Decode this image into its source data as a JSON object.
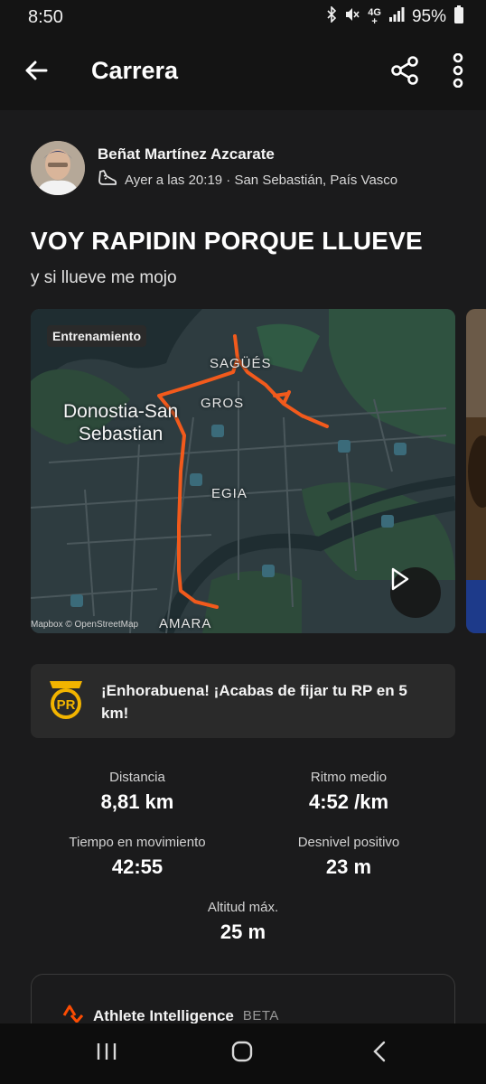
{
  "status_bar": {
    "time": "8:50",
    "network_top": "4G",
    "network_bottom": "+",
    "battery": "95%"
  },
  "app_bar": {
    "title": "Carrera",
    "back_icon": "arrow-left-icon",
    "share_icon": "share-icon",
    "more_icon": "more-vertical-icon"
  },
  "athlete": {
    "name": "Beñat Martínez Azcarate",
    "meta": "Ayer a las 20:19 · San Sebastián, País Vasco",
    "sport_icon": "running-shoe-icon"
  },
  "activity": {
    "title": "VOY RAPIDIN PORQUE LLUEVE",
    "description": "y si llueve me mojo"
  },
  "map": {
    "badge": "Entrenamiento",
    "labels": {
      "city_line1": "Donostia-San",
      "city_line2": "Sebastian",
      "sagues": "SAGÜÉS",
      "gros": "GROS",
      "egia": "EGIA",
      "amara": "AMARA"
    },
    "attribution": "Mapbox © OpenStreetMap",
    "route_color": "#f25a1c",
    "play_icon": "play-icon"
  },
  "pr_banner": {
    "badge_text": "PR",
    "message": "¡Enhorabuena! ¡Acabas de fijar tu RP en 5 km!",
    "accent_color": "#f2b400"
  },
  "stats": [
    {
      "label": "Distancia",
      "value": "8,81 km"
    },
    {
      "label": "Ritmo medio",
      "value": "4:52 /km"
    },
    {
      "label": "Tiempo en movimiento",
      "value": "42:55"
    },
    {
      "label": "Desnivel positivo",
      "value": "23 m"
    },
    {
      "label": "Altitud máx.",
      "value": "25 m"
    }
  ],
  "athlete_intelligence": {
    "title": "Athlete Intelligence",
    "badge": "BETA",
    "icon": "strava-logo-icon",
    "accent_color": "#fc4c02"
  },
  "nav_bar": {
    "recents_icon": "recents-icon",
    "home_icon": "home-icon",
    "back_icon": "back-chevron-icon"
  }
}
